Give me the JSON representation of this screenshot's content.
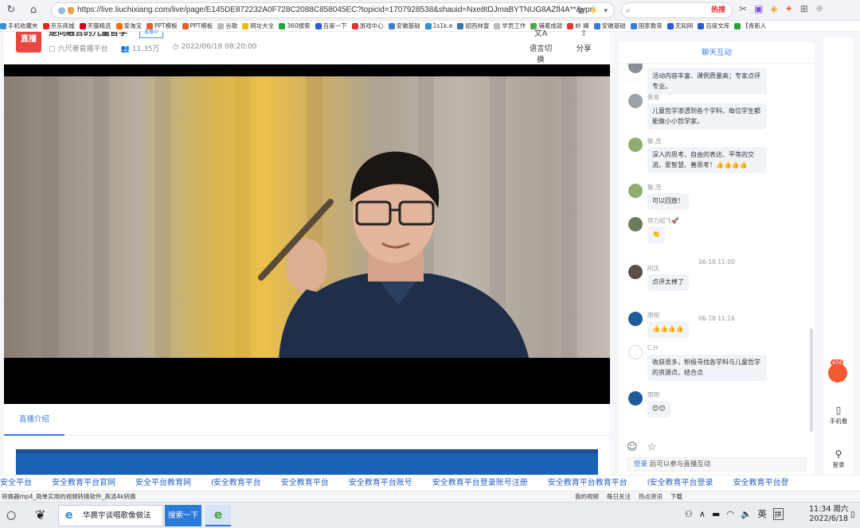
{
  "browser": {
    "url": "https://live.liuchixiang.com/live/page/E145DE872232A0F728C2088C858045EC?topicid=1707928538&shauid=Nxe8tDJmaBYTNUG8AZfl4A**&vpri",
    "search_placeholder": "",
    "search_hot": "热搜",
    "bookmarks": [
      {
        "label": "手机收藏夹",
        "color": "#3a8de0"
      },
      {
        "label": "京东商城",
        "color": "#e1251b"
      },
      {
        "label": "天猫精选",
        "color": "#d0021b"
      },
      {
        "label": "爱淘宝",
        "color": "#ff6a00"
      },
      {
        "label": "PPT模板",
        "color": "#e85c2c"
      },
      {
        "label": "PPT模板",
        "color": "#e85c2c"
      },
      {
        "label": "谷歌",
        "color": "#bbbbbb"
      },
      {
        "label": "网址大全",
        "color": "#f5b800"
      },
      {
        "label": "360搜索",
        "color": "#26a53c"
      },
      {
        "label": "百度一下",
        "color": "#2a5bd7"
      },
      {
        "label": "游戏中心",
        "color": "#d93636"
      },
      {
        "label": "安徽基础",
        "color": "#3a7bd5"
      },
      {
        "label": "1s1k.e",
        "color": "#2f8fd8"
      },
      {
        "label": "貂西林豐",
        "color": "#3d6fb5"
      },
      {
        "label": "学员工作",
        "color": "#bbbbbb"
      },
      {
        "label": "辅着成就",
        "color": "#4aa84a"
      },
      {
        "label": "岭 峰",
        "color": "#d93636"
      },
      {
        "label": "安徽基础",
        "color": "#3a7bd5"
      },
      {
        "label": "国家教育",
        "color": "#3a7bd5"
      },
      {
        "label": "无知网",
        "color": "#2a5bd7"
      },
      {
        "label": "百度文库",
        "color": "#2a5bd7"
      },
      {
        "label": "【青新人",
        "color": "#26a53c"
      }
    ]
  },
  "header": {
    "logo": "直播",
    "title": "是同融合的儿童哲学",
    "badge": "直播中",
    "channel": "六尺巷直播平台",
    "views": "11.35万",
    "datetime": "2022/06/18 08:20:00",
    "language_label": "语言切换",
    "share_label": "分享"
  },
  "tabs": {
    "intro": "直播介绍"
  },
  "chat": {
    "title": "聊天互动",
    "messages": [
      {
        "name": "",
        "text": "活动内容丰富、课例质量高；专家点评专业。",
        "avatar": "#8a8f98"
      },
      {
        "name": "贵哥",
        "text": "儿童哲学渗透到各个学科，每位学生都能做小小哲学家。",
        "avatar": "#9aa3a9"
      },
      {
        "name": "敏.茂",
        "text": "深入的思考、自由的表达、平等的交流、爱智慧、善思考！👍👍👍👍",
        "avatar": "#8fae6e"
      },
      {
        "name": "敏.茂",
        "text": "可以回放！",
        "avatar": "#8fae6e"
      },
      {
        "name": "努力起飞🚀",
        "text": "👏",
        "avatar": "#6b7c5a"
      },
      {
        "name": "阿庆",
        "text": "点评太棒了",
        "avatar": "#5a5046"
      },
      {
        "name": "雨明",
        "text": "👍👍👍👍",
        "avatar": "#1f5b9a"
      },
      {
        "name": "C.H",
        "text": "收获很多，积极寻找各学科与儿童哲学的资源点，结合点",
        "avatar": "#ffffff"
      },
      {
        "name": "雨明",
        "text": "😊😊",
        "avatar": "#1f5b9a"
      }
    ],
    "time1": "06-18 11:00",
    "time2": "06-18 11:16",
    "login_link": "登录",
    "login_text": "后可以参与直播互动"
  },
  "sidebar": {
    "like_count": "474",
    "mobile": "手机看",
    "login": "登录"
  },
  "ads": [
    "安全平台",
    "安全教育平台官网",
    "安全平台教育网",
    "l安全教育平台",
    "安全教育平台",
    "安全教育平台账号",
    "安全教育平台登录账号注册",
    "安全教育平台教育平台",
    "l安全教育平台登录",
    "安全教育平台登"
  ],
  "status": {
    "left": "转换器mp4_简单实用的视频转换软件_高清4k转换",
    "items": [
      "我的视频",
      "每日关注",
      "热点资讯",
      "下载"
    ]
  },
  "taskbar": {
    "window_title": "华晨宇谈唱歌像做法",
    "search_button": "搜索一下",
    "ime": "英",
    "ime2": "拼",
    "time": "11:34 周六",
    "date": "2022/6/18"
  }
}
